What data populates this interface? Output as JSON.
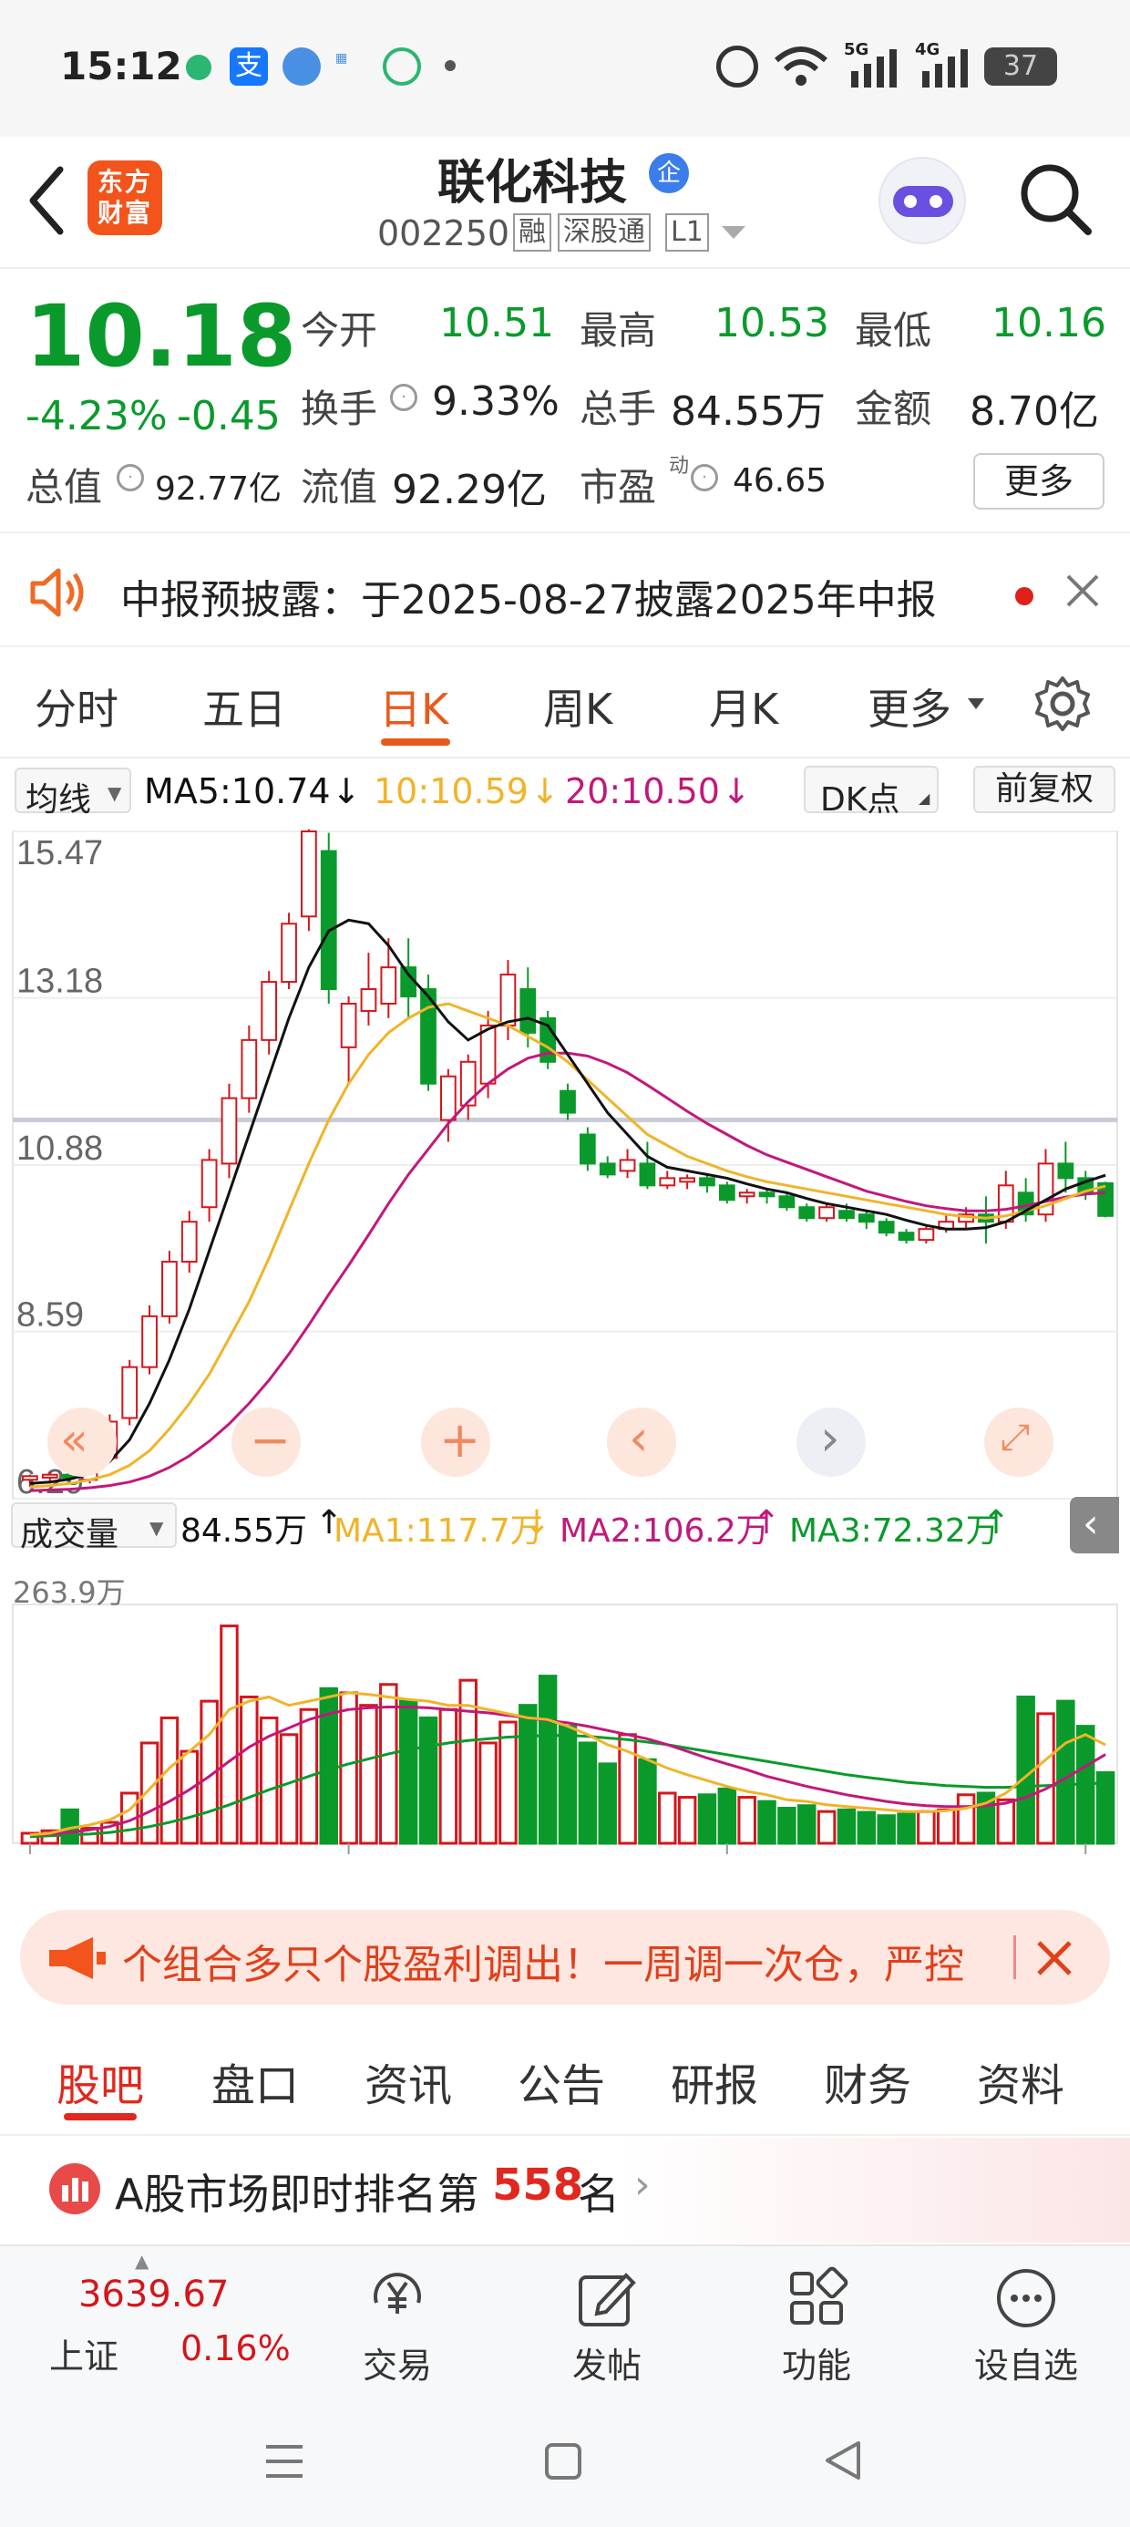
{
  "status_bar": {
    "time": "15:12",
    "battery": "37",
    "signal_5g": "5G",
    "signal_4g": "4G"
  },
  "header": {
    "logo_text": "东方财富",
    "stock_name": "联化科技",
    "stock_badge": "企",
    "stock_code": "002250",
    "tags": [
      "融",
      "深股通",
      "L1"
    ]
  },
  "quote": {
    "price": "10.18",
    "change_pct": "-4.23%",
    "change": "-0.45",
    "open_label": "今开",
    "open": "10.51",
    "high_label": "最高",
    "high": "10.53",
    "low_label": "最低",
    "low": "10.16",
    "turnover_label": "换手",
    "turnover": "9.33%",
    "volume_label": "总手",
    "volume": "84.55万",
    "amount_label": "金额",
    "amount": "8.70亿",
    "mcap_label": "总值",
    "mcap": "92.77亿",
    "float_label": "流值",
    "float_mcap": "92.29亿",
    "pe_label": "市盈",
    "pe_sup": "动",
    "pe": "46.65",
    "more_button": "更多"
  },
  "notice": {
    "text": "中报预披露：于2025-08-27披露2025年中报"
  },
  "chart_tabs": [
    "分时",
    "五日",
    "日K",
    "周K",
    "月K",
    "更多"
  ],
  "active_chart_tab": 2,
  "ma_bar": {
    "selector": "均线",
    "ma5": "MA5:10.74",
    "ma10": "10:10.59",
    "ma20": "20:10.50",
    "dk_button": "DK点",
    "adjust_button": "前复权"
  },
  "vol_bar": {
    "selector": "成交量",
    "vol": "84.55万",
    "ma1": "MA1:117.7万",
    "ma2": "MA2:106.2万",
    "ma3": "MA3:72.32万",
    "max_label": "263.9万"
  },
  "colors": {
    "up": "#d4161b",
    "down": "#0a9a2b",
    "ma5": "#111111",
    "ma10": "#f0b429",
    "ma20": "#c2187b",
    "accent": "#e85a1c"
  },
  "chart_data": {
    "type": "candlestick",
    "y_ticks": [
      "15.47",
      "13.18",
      "10.88",
      "8.59",
      "6.29"
    ],
    "ylim": [
      6.29,
      15.47
    ],
    "x_ticks": [
      "20250520",
      "20250612",
      "20250710",
      "20250807"
    ],
    "candles": [
      [
        6.55,
        6.6,
        6.45,
        6.62
      ],
      [
        6.58,
        6.62,
        6.5,
        6.66
      ],
      [
        6.62,
        6.58,
        6.5,
        6.66
      ],
      [
        6.55,
        6.85,
        6.5,
        6.92
      ],
      [
        6.85,
        7.35,
        6.8,
        7.45
      ],
      [
        7.4,
        8.1,
        7.3,
        8.2
      ],
      [
        8.1,
        8.8,
        8.0,
        8.95
      ],
      [
        8.8,
        9.55,
        8.7,
        9.7
      ],
      [
        9.55,
        10.1,
        9.4,
        10.25
      ],
      [
        10.3,
        10.95,
        10.1,
        11.1
      ],
      [
        10.9,
        11.8,
        10.7,
        12.0
      ],
      [
        11.8,
        12.6,
        11.6,
        12.8
      ],
      [
        12.6,
        13.4,
        12.4,
        13.55
      ],
      [
        13.4,
        14.2,
        13.3,
        14.35
      ],
      [
        14.3,
        15.47,
        14.1,
        15.5
      ],
      [
        15.2,
        13.3,
        13.1,
        15.45
      ],
      [
        12.5,
        13.1,
        12.0,
        13.2
      ],
      [
        13.0,
        13.3,
        12.8,
        13.8
      ],
      [
        13.1,
        13.6,
        12.9,
        14.0
      ],
      [
        13.6,
        13.2,
        12.9,
        14.0
      ],
      [
        13.3,
        12.0,
        11.9,
        13.5
      ],
      [
        11.5,
        12.1,
        11.2,
        12.2
      ],
      [
        11.7,
        12.3,
        11.5,
        12.4
      ],
      [
        12.0,
        12.8,
        11.8,
        13.0
      ],
      [
        12.8,
        13.5,
        12.6,
        13.7
      ],
      [
        13.3,
        12.7,
        12.5,
        13.6
      ],
      [
        12.9,
        12.3,
        12.2,
        13.0
      ],
      [
        11.9,
        11.6,
        11.5,
        12.0
      ],
      [
        11.3,
        10.9,
        10.8,
        11.4
      ],
      [
        10.9,
        10.75,
        10.7,
        11.0
      ],
      [
        10.8,
        10.95,
        10.7,
        11.1
      ],
      [
        10.9,
        10.6,
        10.55,
        11.2
      ],
      [
        10.6,
        10.7,
        10.55,
        10.8
      ],
      [
        10.65,
        10.7,
        10.55,
        10.75
      ],
      [
        10.7,
        10.6,
        10.5,
        10.75
      ],
      [
        10.6,
        10.4,
        10.35,
        10.65
      ],
      [
        10.45,
        10.5,
        10.35,
        10.55
      ],
      [
        10.5,
        10.45,
        10.35,
        10.55
      ],
      [
        10.45,
        10.3,
        10.25,
        10.5
      ],
      [
        10.3,
        10.15,
        10.1,
        10.35
      ],
      [
        10.15,
        10.3,
        10.1,
        10.35
      ],
      [
        10.25,
        10.15,
        10.1,
        10.35
      ],
      [
        10.2,
        10.1,
        10.0,
        10.25
      ],
      [
        10.1,
        9.95,
        9.9,
        10.15
      ],
      [
        9.95,
        9.85,
        9.8,
        10.0
      ],
      [
        9.85,
        10.0,
        9.8,
        10.05
      ],
      [
        10.0,
        10.1,
        9.95,
        10.2
      ],
      [
        10.1,
        10.2,
        10.0,
        10.3
      ],
      [
        10.2,
        10.1,
        9.8,
        10.45
      ],
      [
        10.1,
        10.6,
        10.0,
        10.8
      ],
      [
        10.5,
        10.2,
        10.1,
        10.7
      ],
      [
        10.2,
        10.9,
        10.1,
        11.1
      ],
      [
        10.9,
        10.7,
        10.5,
        11.2
      ],
      [
        10.7,
        10.5,
        10.4,
        10.8
      ],
      [
        10.63,
        10.18,
        10.16,
        10.65
      ]
    ],
    "ma5": [
      6.5,
      6.52,
      6.56,
      6.63,
      6.8,
      7.1,
      7.6,
      8.2,
      8.9,
      9.7,
      10.5,
      11.3,
      12.1,
      12.9,
      13.6,
      14.1,
      14.25,
      14.2,
      13.9,
      13.5,
      13.2,
      12.85,
      12.6,
      12.75,
      12.85,
      12.9,
      12.8,
      12.4,
      12.0,
      11.6,
      11.3,
      11.0,
      10.85,
      10.8,
      10.75,
      10.7,
      10.62,
      10.55,
      10.5,
      10.42,
      10.35,
      10.3,
      10.25,
      10.2,
      10.12,
      10.05,
      10.0,
      10.0,
      10.02,
      10.1,
      10.25,
      10.4,
      10.55,
      10.65,
      10.74
    ],
    "ma10": [
      6.45,
      6.47,
      6.5,
      6.55,
      6.62,
      6.75,
      6.95,
      7.25,
      7.6,
      8.0,
      8.5,
      9.0,
      9.6,
      10.25,
      10.9,
      11.5,
      12.0,
      12.4,
      12.7,
      12.9,
      13.05,
      13.1,
      13.0,
      12.9,
      12.8,
      12.65,
      12.5,
      12.3,
      12.05,
      11.8,
      11.55,
      11.3,
      11.15,
      11.0,
      10.9,
      10.8,
      10.72,
      10.65,
      10.6,
      10.55,
      10.5,
      10.45,
      10.4,
      10.35,
      10.3,
      10.25,
      10.2,
      10.17,
      10.15,
      10.18,
      10.25,
      10.32,
      10.42,
      10.52,
      10.59
    ],
    "ma20": [
      6.4,
      6.41,
      6.42,
      6.44,
      6.47,
      6.52,
      6.6,
      6.72,
      6.88,
      7.08,
      7.32,
      7.6,
      7.92,
      8.28,
      8.68,
      9.1,
      9.5,
      9.92,
      10.35,
      10.75,
      11.1,
      11.45,
      11.75,
      12.0,
      12.2,
      12.35,
      12.42,
      12.42,
      12.38,
      12.28,
      12.15,
      11.98,
      11.8,
      11.62,
      11.45,
      11.3,
      11.15,
      11.02,
      10.92,
      10.82,
      10.72,
      10.62,
      10.52,
      10.45,
      10.38,
      10.32,
      10.28,
      10.25,
      10.25,
      10.27,
      10.32,
      10.38,
      10.44,
      10.48,
      10.5
    ],
    "volumes": [
      12,
      15,
      40,
      18,
      25,
      60,
      120,
      150,
      110,
      170,
      260,
      175,
      150,
      130,
      160,
      185,
      180,
      165,
      190,
      170,
      150,
      160,
      195,
      120,
      145,
      165,
      200,
      140,
      120,
      95,
      130,
      100,
      60,
      55,
      58,
      65,
      55,
      50,
      42,
      45,
      38,
      40,
      37,
      33,
      35,
      38,
      40,
      58,
      60,
      52,
      175,
      155,
      170,
      140,
      84.55
    ],
    "vol_max": 263.9,
    "vol_ma1": [
      10,
      12,
      18,
      22,
      28,
      40,
      65,
      90,
      110,
      130,
      160,
      170,
      175,
      165,
      170,
      175,
      180,
      178,
      175,
      172,
      170,
      165,
      165,
      160,
      155,
      150,
      148,
      140,
      130,
      118,
      110,
      100,
      90,
      82,
      75,
      68,
      62,
      58,
      52,
      50,
      46,
      44,
      42,
      40,
      38,
      38,
      39,
      42,
      48,
      60,
      80,
      100,
      120,
      130,
      117.7
    ],
    "vol_ma2": [
      10,
      11,
      13,
      16,
      20,
      27,
      38,
      50,
      64,
      80,
      98,
      115,
      128,
      138,
      148,
      155,
      160,
      162,
      163,
      163,
      162,
      160,
      158,
      156,
      153,
      150,
      147,
      144,
      140,
      135,
      130,
      125,
      118,
      110,
      102,
      95,
      88,
      80,
      74,
      68,
      63,
      58,
      54,
      50,
      47,
      45,
      44,
      44,
      45,
      48,
      55,
      65,
      78,
      92,
      106.2
    ],
    "vol_ma3": [
      8,
      9,
      10,
      11,
      13,
      16,
      20,
      25,
      31,
      38,
      46,
      55,
      64,
      72,
      80,
      88,
      95,
      101,
      107,
      112,
      116,
      120,
      123,
      125,
      127,
      128,
      129,
      129,
      128,
      126,
      124,
      121,
      118,
      114,
      110,
      106,
      102,
      98,
      94,
      90,
      86,
      82,
      79,
      76,
      73,
      71,
      69,
      68,
      67,
      67,
      68,
      69,
      70,
      71,
      72.32
    ]
  },
  "ad": {
    "text": "个组合多只个股盈利调出！一周调一次仓，严控"
  },
  "sub_tabs": [
    "股吧",
    "盘口",
    "资讯",
    "公告",
    "研报",
    "财务",
    "资料"
  ],
  "active_sub_tab": 0,
  "rank": {
    "prefix": "A股市场即时排名第",
    "number": "558",
    "suffix": "名"
  },
  "bottom_bar": {
    "index_value": "3639.67",
    "index_name": "上证",
    "index_change": "0.16%",
    "trade": "交易",
    "post": "发帖",
    "function": "功能",
    "watchlist": "设自选"
  }
}
